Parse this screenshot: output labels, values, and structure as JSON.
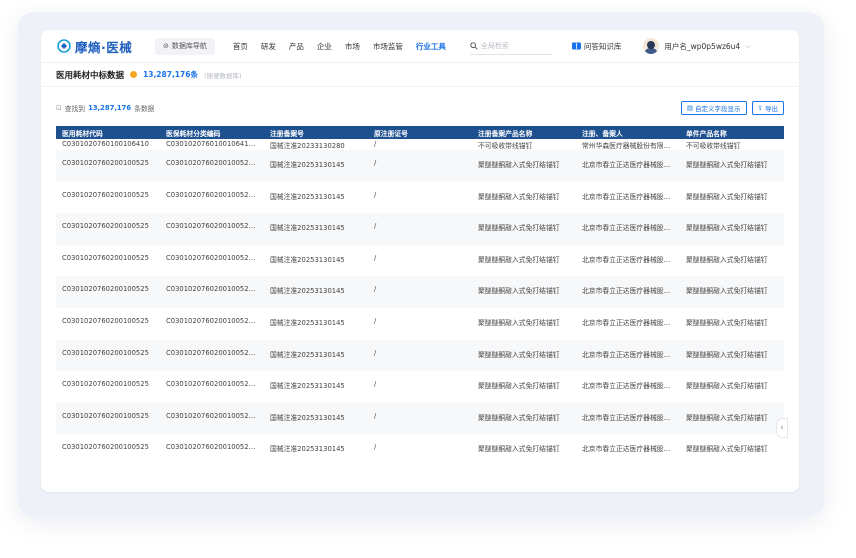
{
  "brand": {
    "name": "摩熵·医械",
    "accent": "#1a73e8",
    "header_color": "#1e4f8f"
  },
  "nav": {
    "db_nav_label": "数据库导航",
    "items": [
      "首页",
      "研发",
      "产品",
      "企业",
      "市场",
      "市场监管",
      "行业工具"
    ],
    "active_index": 6,
    "search_placeholder": "全局检索",
    "knowledge_base": "问答知识库",
    "username": "用户名_wp0p5wz6u4"
  },
  "page": {
    "title": "医用耗材中标数据",
    "total_count": "13,287,176条",
    "sub_note": "(随便数据库)",
    "found_prefix": "查找到",
    "found_count": "13,287,176",
    "found_suffix": "条数据",
    "custom_fields_btn": "自定义字段显示",
    "export_btn": "导出"
  },
  "table": {
    "columns": [
      "医用耗材代码",
      "医保耗材分类编码",
      "注册备案号",
      "原注册证号",
      "注册备案产品名称",
      "注册、备案人",
      "单件产品名称"
    ],
    "rows": [
      [
        "C0301020760100106410",
        "C0301020760100106410000...",
        "国械注准20233130280",
        "/",
        "不可吸收带线锚钉",
        "常州华森医疗器械股份有限...",
        "不可吸收带线锚钉"
      ],
      [
        "C0301020760200100525",
        "C0301020760200100525000...",
        "国械注准20253130145",
        "/",
        "聚醚醚酮敲入式免打结锚钉",
        "北京市春立正达医疗器械股...",
        "聚醚醚酮敲入式免打结锚钉"
      ],
      [
        "C0301020760200100525",
        "C0301020760200100525000...",
        "国械注准20253130145",
        "/",
        "聚醚醚酮敲入式免打结锚钉",
        "北京市春立正达医疗器械股...",
        "聚醚醚酮敲入式免打结锚钉"
      ],
      [
        "C0301020760200100525",
        "C0301020760200100525000...",
        "国械注准20253130145",
        "/",
        "聚醚醚酮敲入式免打结锚钉",
        "北京市春立正达医疗器械股...",
        "聚醚醚酮敲入式免打结锚钉"
      ],
      [
        "C0301020760200100525",
        "C0301020760200100525000...",
        "国械注准20253130145",
        "/",
        "聚醚醚酮敲入式免打结锚钉",
        "北京市春立正达医疗器械股...",
        "聚醚醚酮敲入式免打结锚钉"
      ],
      [
        "C0301020760200100525",
        "C0301020760200100525000...",
        "国械注准20253130145",
        "/",
        "聚醚醚酮敲入式免打结锚钉",
        "北京市春立正达医疗器械股...",
        "聚醚醚酮敲入式免打结锚钉"
      ],
      [
        "C0301020760200100525",
        "C0301020760200100525000...",
        "国械注准20253130145",
        "/",
        "聚醚醚酮敲入式免打结锚钉",
        "北京市春立正达医疗器械股...",
        "聚醚醚酮敲入式免打结锚钉"
      ],
      [
        "C0301020760200100525",
        "C0301020760200100525000...",
        "国械注准20253130145",
        "/",
        "聚醚醚酮敲入式免打结锚钉",
        "北京市春立正达医疗器械股...",
        "聚醚醚酮敲入式免打结锚钉"
      ],
      [
        "C0301020760200100525",
        "C0301020760200100525000...",
        "国械注准20253130145",
        "/",
        "聚醚醚酮敲入式免打结锚钉",
        "北京市春立正达医疗器械股...",
        "聚醚醚酮敲入式免打结锚钉"
      ],
      [
        "C0301020760200100525",
        "C0301020760200100525000...",
        "国械注准20253130145",
        "/",
        "聚醚醚酮敲入式免打结锚钉",
        "北京市春立正达医疗器械股...",
        "聚醚醚酮敲入式免打结锚钉"
      ],
      [
        "C0301020760200100525",
        "C0301020760200100525000...",
        "国械注准20253130145",
        "/",
        "聚醚醚酮敲入式免打结锚钉",
        "北京市春立正达医疗器械股...",
        "聚醚醚酮敲入式免打结锚钉"
      ]
    ]
  },
  "icons": {
    "logo": "logo-icon",
    "db_nav": "compass-icon",
    "search": "search-icon",
    "kb": "book-icon",
    "dropdown": "chevron-down-icon",
    "custom": "columns-icon",
    "export": "export-icon",
    "collapse": "chevron-left-icon",
    "info": "info-icon"
  }
}
